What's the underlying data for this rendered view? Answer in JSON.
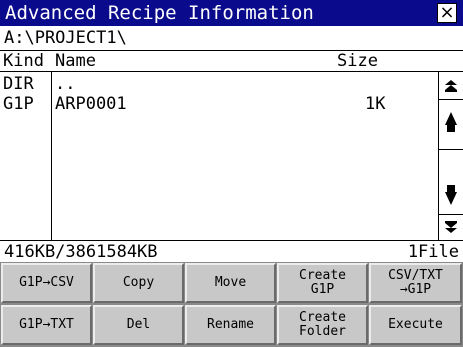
{
  "window": {
    "title": "Advanced Recipe Information",
    "close_symbol": "×"
  },
  "path": "A:\\PROJECT1\\",
  "columns": {
    "kind": "Kind",
    "name": "Name",
    "size": "Size"
  },
  "files": [
    {
      "kind": "DIR",
      "name": "..",
      "size": ""
    },
    {
      "kind": "G1P",
      "name": "ARP0001",
      "size": "1K"
    }
  ],
  "status": {
    "capacity": "416KB/3861584KB",
    "count": "1File"
  },
  "scrollbar": {
    "icons": [
      "page-up-icon",
      "line-up-icon",
      "line-down-icon",
      "page-down-icon"
    ]
  },
  "buttons": [
    [
      "G1P→CSV",
      "Copy",
      "Move",
      "Create\nG1P",
      "CSV/TXT\n→G1P"
    ],
    [
      "G1P→TXT",
      "Del",
      "Rename",
      "Create\nFolder",
      "Execute"
    ]
  ],
  "colors": {
    "titlebar": "#0a0a8c",
    "button_face": "#c8c8c8",
    "button_area": "#8a8a8a"
  }
}
